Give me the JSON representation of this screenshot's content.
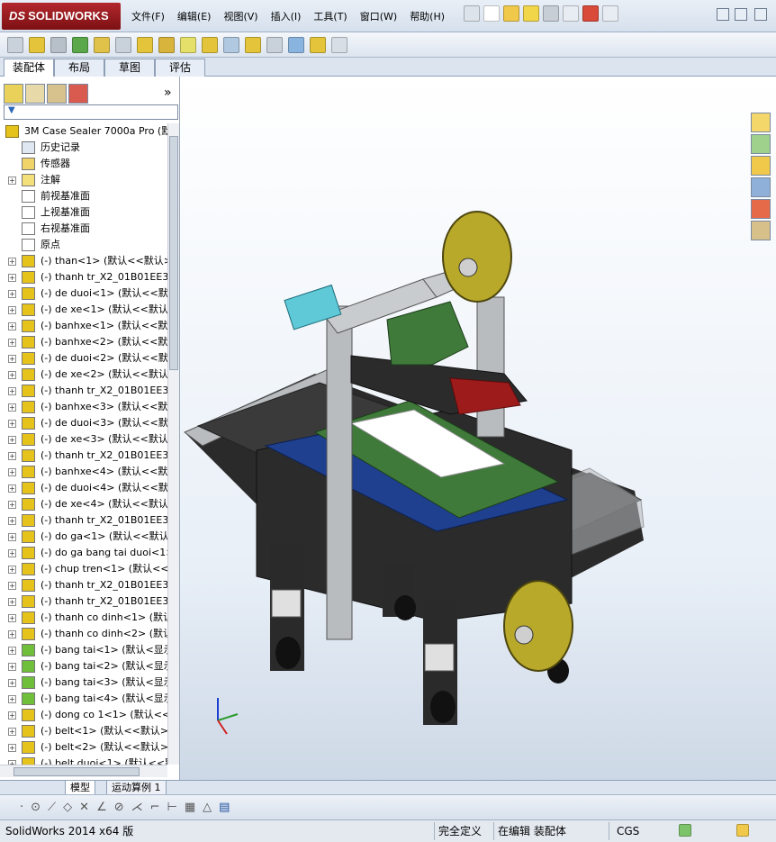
{
  "app": {
    "logo_prefix": "DS",
    "logo_text": "SOLIDWORKS"
  },
  "menu": [
    "文件(F)",
    "编辑(E)",
    "视图(V)",
    "插入(I)",
    "工具(T)",
    "窗口(W)",
    "帮助(H)"
  ],
  "tabs": [
    "装配体",
    "布局",
    "草图",
    "评估"
  ],
  "filter_icon": "funnel-icon",
  "tree": {
    "root": "3M Case Sealer 7000a Pro  (默认",
    "items": [
      {
        "label": "历史记录",
        "icon": "history-icon",
        "expand": false
      },
      {
        "label": "传感器",
        "icon": "sensor-icon",
        "expand": false
      },
      {
        "label": "注解",
        "icon": "annotation-icon",
        "expand": true
      },
      {
        "label": "前视基准面",
        "icon": "plane-icon",
        "expand": false
      },
      {
        "label": "上视基准面",
        "icon": "plane-icon",
        "expand": false
      },
      {
        "label": "右视基准面",
        "icon": "plane-icon",
        "expand": false
      },
      {
        "label": "原点",
        "icon": "origin-icon",
        "expand": false
      },
      {
        "label": "(-) than<1> (默认<<默认>_",
        "icon": "part-icon",
        "expand": true
      },
      {
        "label": "(-) thanh tr_X2_01B01EE3_X0",
        "icon": "part-icon",
        "expand": true
      },
      {
        "label": "(-) de duoi<1> (默认<<默认",
        "icon": "part-icon",
        "expand": true
      },
      {
        "label": "(-) de xe<1> (默认<<默认>_",
        "icon": "part-icon",
        "expand": true
      },
      {
        "label": "(-) banhxe<1> (默认<<默认",
        "icon": "part-icon",
        "expand": true
      },
      {
        "label": "(-) banhxe<2> (默认<<默认",
        "icon": "part-icon",
        "expand": true
      },
      {
        "label": "(-) de duoi<2> (默认<<默认",
        "icon": "part-icon",
        "expand": true
      },
      {
        "label": "(-) de xe<2> (默认<<默认>_",
        "icon": "part-icon",
        "expand": true
      },
      {
        "label": "(-) thanh tr_X2_01B01EE3_X0",
        "icon": "part-icon",
        "expand": true
      },
      {
        "label": "(-) banhxe<3> (默认<<默认",
        "icon": "part-icon",
        "expand": true
      },
      {
        "label": "(-) de duoi<3> (默认<<默认",
        "icon": "part-icon",
        "expand": true
      },
      {
        "label": "(-) de xe<3> (默认<<默认>_",
        "icon": "part-icon",
        "expand": true
      },
      {
        "label": "(-) thanh tr_X2_01B01EE3_X0",
        "icon": "part-icon",
        "expand": true
      },
      {
        "label": "(-) banhxe<4> (默认<<默认",
        "icon": "part-icon",
        "expand": true
      },
      {
        "label": "(-) de duoi<4> (默认<<默认",
        "icon": "part-icon",
        "expand": true
      },
      {
        "label": "(-) de xe<4> (默认<<默认>_",
        "icon": "part-icon",
        "expand": true
      },
      {
        "label": "(-) thanh tr_X2_01B01EE3_X0",
        "icon": "part-icon",
        "expand": true
      },
      {
        "label": "(-) do ga<1> (默认<<默认>_",
        "icon": "part-icon",
        "expand": true
      },
      {
        "label": "(-) do ga bang tai duoi<1> (默",
        "icon": "part-icon",
        "expand": true
      },
      {
        "label": "(-) chup tren<1> (默认<<默",
        "icon": "part-icon",
        "expand": true
      },
      {
        "label": "(-) thanh tr_X2_01B01EE3_X0",
        "icon": "part-icon",
        "expand": true
      },
      {
        "label": "(-) thanh tr_X2_01B01EE3_X0",
        "icon": "part-icon",
        "expand": true
      },
      {
        "label": "(-) thanh co dinh<1> (默认<",
        "icon": "part-icon",
        "expand": true
      },
      {
        "label": "(-) thanh co dinh<2> (默认<",
        "icon": "part-icon",
        "expand": true
      },
      {
        "label": "(-) bang tai<1> (默认<显示",
        "icon": "subassembly-icon",
        "expand": true
      },
      {
        "label": "(-) bang tai<2> (默认<显示",
        "icon": "subassembly-icon",
        "expand": true
      },
      {
        "label": "(-) bang tai<3> (默认<显示",
        "icon": "subassembly-icon",
        "expand": true
      },
      {
        "label": "(-) bang tai<4> (默认<显示",
        "icon": "subassembly-icon",
        "expand": true
      },
      {
        "label": "(-) dong co 1<1> (默认<<默",
        "icon": "part-icon",
        "expand": true
      },
      {
        "label": "(-) belt<1> (默认<<默认>_",
        "icon": "part-icon",
        "expand": true
      },
      {
        "label": "(-) belt<2> (默认<<默认>_",
        "icon": "part-icon",
        "expand": true
      },
      {
        "label": "(-) belt duoi<1> (默认<<默",
        "icon": "part-icon",
        "expand": true
      }
    ]
  },
  "bottom_tabs": [
    "模型",
    "运动算例 1"
  ],
  "status": {
    "version": "SolidWorks 2014 x64 版",
    "definition": "完全定义",
    "editing": "在编辑 装配体",
    "units": "CGS"
  },
  "colors": {
    "part_yellow": "#e6c31b",
    "subassembly_green": "#6fbf3a",
    "frame_gray": "#b9bcbf",
    "tape_olive": "#b8a92a",
    "belt_blue": "#1f3f8f",
    "plate_green": "#3f7a3a"
  }
}
